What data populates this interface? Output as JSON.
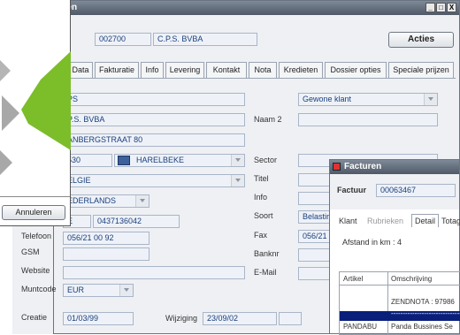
{
  "main_window": {
    "title": "nten",
    "code": "002700",
    "company_short": "C.P.S. BVBA",
    "actions_label": "Acties",
    "tabs": [
      "Data",
      "Fakturatie",
      "Info",
      "Levering",
      "Kontakt",
      "Nota",
      "Kredieten",
      "Dossier opties",
      "Speciale prijzen"
    ],
    "fields": {
      "name1": "PS",
      "name_full": "P.S. BVBA",
      "street": "ANBERGSTRAAT 80",
      "postcode": "530",
      "city": "HARELBEKE",
      "country": "ELGIE",
      "language": "EDERLANDS",
      "vat_prefix": "E",
      "vat_number": "0437136042",
      "phone": "056/21 00 92",
      "gsm": "",
      "website": "",
      "currency": "EUR",
      "created": "01/03/99",
      "modified": "23/09/02",
      "client_type": "Gewone klant",
      "naam2": "",
      "sector": "",
      "titel": "",
      "info": "",
      "soort": "Belastir",
      "fax": "056/21",
      "banknr": "",
      "email": ""
    },
    "labels": {
      "naam2": "Naam 2",
      "sector": "Sector",
      "titel": "Titel",
      "info": "Info",
      "soort": "Soort",
      "fax": "Fax",
      "banknr": "Banknr",
      "email": "E-Mail",
      "telefoon": "Telefoon",
      "gsm": "GSM",
      "website": "Website",
      "muntcode": "Muntcode",
      "creatie": "Creatie",
      "wijziging": "Wijziging"
    }
  },
  "dialog": {
    "cancel_label": "Annuleren"
  },
  "facturen": {
    "title": "Facturen",
    "factuur_label": "Factuur",
    "factuur_value": "00063467",
    "tabs": [
      "Klant",
      "Rubrieken",
      "Detail",
      "Totag"
    ],
    "distance_text": "Afstand in km : 4",
    "col_artikel": "Artikel",
    "col_omschrijving": "Omschrijving",
    "rows": [
      {
        "artikel": "",
        "omschrijving": "ZENDNOTA : 97986"
      },
      {
        "artikel": "",
        "omschrijving": "------------------------------"
      },
      {
        "artikel": "PANDABU",
        "omschrijving": "Panda Bussines Se"
      }
    ]
  },
  "colors": {
    "accent_green": "#7cbd2a",
    "title_bar": "#5a6472",
    "field_text": "#1b3f7c",
    "selected_row": "#0a1f7a"
  }
}
